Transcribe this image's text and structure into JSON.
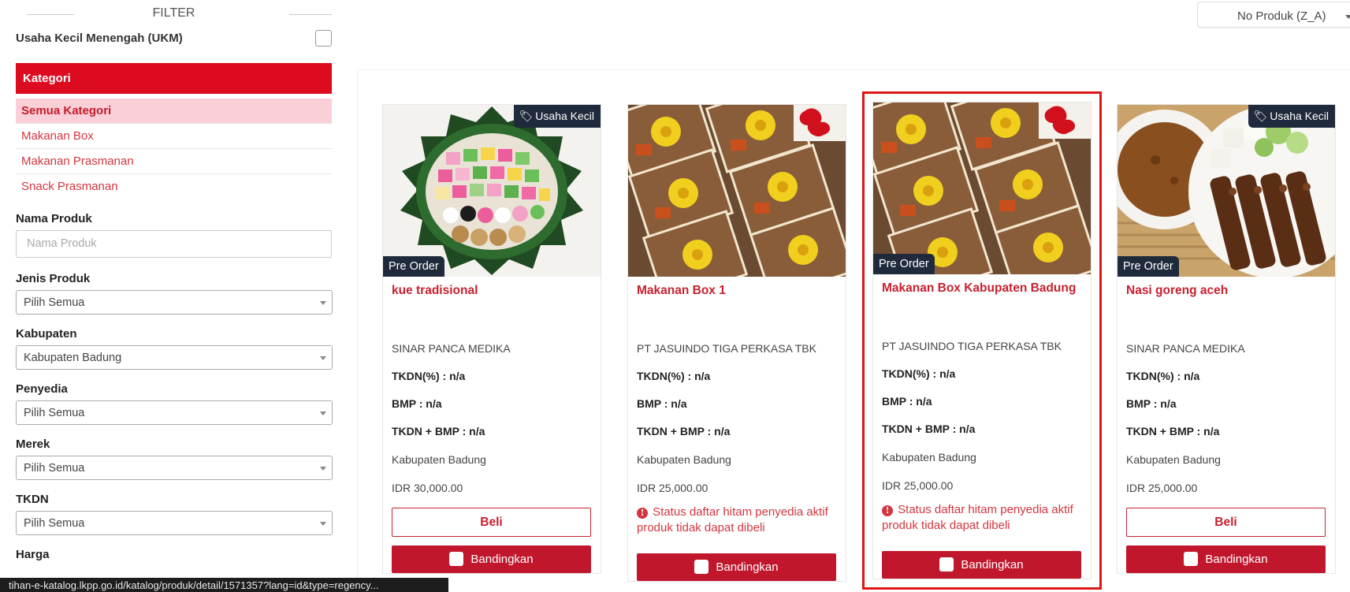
{
  "filter": {
    "title": "FILTER",
    "ukm_label": "Usaha Kecil Menengah (UKM)",
    "kategori": {
      "header": "Kategori",
      "items": [
        "Semua Kategori",
        "Makanan Box",
        "Makanan Prasmanan",
        "Snack Prasmanan"
      ]
    },
    "nama_produk": {
      "label": "Nama Produk",
      "placeholder": "Nama Produk"
    },
    "jenis_produk": {
      "label": "Jenis Produk",
      "value": "Pilih Semua"
    },
    "kabupaten": {
      "label": "Kabupaten",
      "value": "Kabupaten Badung"
    },
    "penyedia": {
      "label": "Penyedia",
      "value": "Pilih Semua"
    },
    "merek": {
      "label": "Merek",
      "value": "Pilih Semua"
    },
    "tkdn": {
      "label": "TKDN",
      "value": "Pilih Semua"
    },
    "harga": {
      "label": "Harga"
    }
  },
  "sort": {
    "value": "No Produk (Z_A)"
  },
  "products": [
    {
      "name": "kue tradisional",
      "vendor": "SINAR PANCA MEDIKA",
      "tkdn": "TKDN(%) : n/a",
      "bmp": "BMP : n/a",
      "tkdn_bmp": "TKDN + BMP : n/a",
      "region": "Kabupaten Badung",
      "price": "IDR 30,000.00",
      "badge_top": "Usaha Kecil",
      "badge_bottom": "Pre Order",
      "action": "Beli",
      "compare": "Bandingkan"
    },
    {
      "name": "Makanan Box 1",
      "vendor": "PT JASUINDO TIGA PERKASA TBK",
      "tkdn": "TKDN(%) : n/a",
      "bmp": "BMP : n/a",
      "tkdn_bmp": "TKDN + BMP : n/a",
      "region": "Kabupaten Badung",
      "price": "IDR 25,000.00",
      "warning": "Status daftar hitam penyedia aktif produk tidak dapat dibeli",
      "compare": "Bandingkan"
    },
    {
      "name": "Makanan Box Kabupaten Badung",
      "vendor": "PT JASUINDO TIGA PERKASA TBK",
      "tkdn": "TKDN(%) : n/a",
      "bmp": "BMP : n/a",
      "tkdn_bmp": "TKDN + BMP : n/a",
      "region": "Kabupaten Badung",
      "price": "IDR 25,000.00",
      "badge_bottom": "Pre Order",
      "warning": "Status daftar hitam penyedia aktif produk tidak dapat dibeli",
      "compare": "Bandingkan"
    },
    {
      "name": "Nasi goreng aceh",
      "vendor": "SINAR PANCA MEDIKA",
      "tkdn": "TKDN(%) : n/a",
      "bmp": "BMP : n/a",
      "tkdn_bmp": "TKDN + BMP : n/a",
      "region": "Kabupaten Badung",
      "price": "IDR 25,000.00",
      "badge_top": "Usaha Kecil",
      "badge_bottom": "Pre Order",
      "action": "Beli",
      "compare": "Bandingkan"
    }
  ],
  "statusbar": {
    "url": "tihan-e-katalog.lkpp.go.id/katalog/produk/detail/1571357?lang=id&type=regency..."
  },
  "colors": {
    "accent": "#dc0b20",
    "active_bg": "#fbcfd7",
    "button": "#c1172d",
    "badge": "#1f2a3c",
    "selection": "#e01515"
  }
}
